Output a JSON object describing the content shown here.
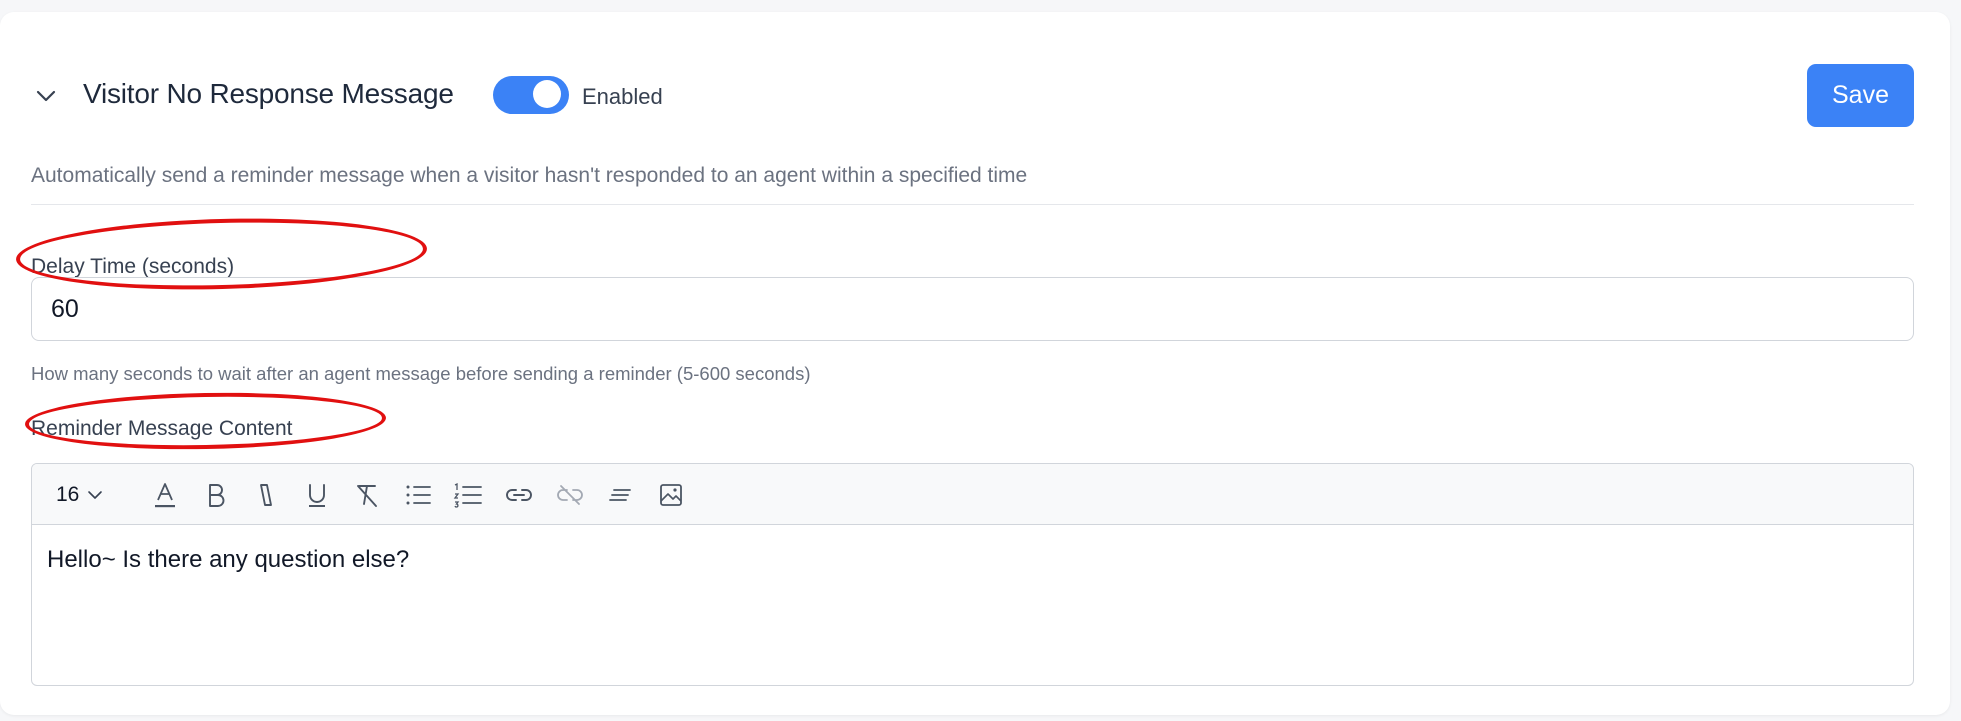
{
  "section": {
    "title": "Visitor No Response Message",
    "toggle_label": "Enabled",
    "toggle_on": true,
    "description": "Automatically send a reminder message when a visitor hasn't responded to an agent within a specified time"
  },
  "actions": {
    "save_label": "Save"
  },
  "delay_field": {
    "label": "Delay Time (seconds)",
    "value": "60",
    "help": "How many seconds to wait after an agent message before sending a reminder (5-600 seconds)"
  },
  "reminder_field": {
    "label": "Reminder Message Content",
    "font_size": "16",
    "content": "Hello~ Is there any question else?"
  },
  "toolbar_icons": [
    "font-color-icon",
    "bold-icon",
    "italic-icon",
    "underline-icon",
    "clear-format-icon",
    "bullet-list-icon",
    "numbered-list-icon",
    "link-icon",
    "unlink-icon",
    "align-icon",
    "image-icon"
  ],
  "colors": {
    "accent": "#3b82f6",
    "annotation": "#e11010"
  }
}
